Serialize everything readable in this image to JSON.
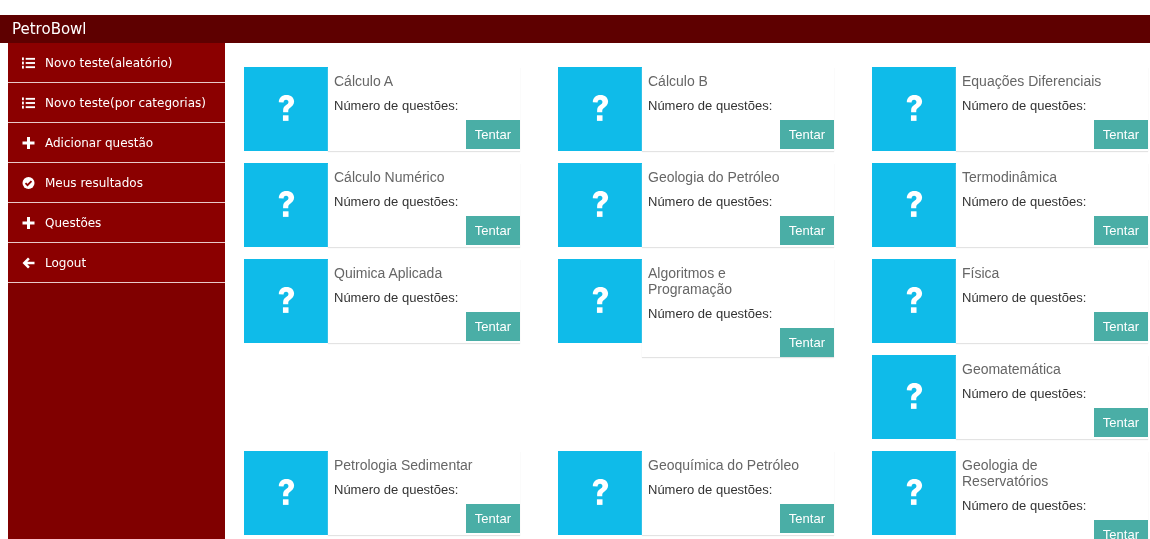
{
  "header": {
    "title": "PetroBowl"
  },
  "sidebar": {
    "items": [
      {
        "label": "Novo teste(aleatório)",
        "kind": "list"
      },
      {
        "label": "Novo teste(por categorias)",
        "kind": "list"
      },
      {
        "label": "Adicionar questão",
        "kind": "plus"
      },
      {
        "label": "Meus resultados",
        "kind": "check"
      },
      {
        "label": "Questões",
        "kind": "plus"
      },
      {
        "label": "Logout",
        "kind": "back"
      }
    ]
  },
  "card_groups": [
    {
      "cards": [
        {
          "title": "Cálculo A",
          "label": "Número de questões:",
          "button": "Tentar"
        },
        {
          "title": "Cálculo B",
          "label": "Número de questões:",
          "button": "Tentar"
        },
        {
          "title": "Equações Diferenciais",
          "label": "Número de questões:",
          "button": "Tentar"
        },
        {
          "title": "Cálculo Numérico",
          "label": "Número de questões:",
          "button": "Tentar"
        },
        {
          "title": "Geologia do Petróleo",
          "label": "Número de questões:",
          "button": "Tentar"
        },
        {
          "title": "Termodinâmica",
          "label": "Número de questões:",
          "button": "Tentar"
        },
        {
          "title": "Quimica Aplicada",
          "label": "Número de questões:",
          "button": "Tentar"
        },
        {
          "title": "Algoritmos e Programação",
          "label": "Número de questões:",
          "button": "Tentar"
        },
        {
          "title": "Física",
          "label": "Número de questões:",
          "button": "Tentar"
        },
        {
          "title": "Geomatemática",
          "label": "Número de questões:",
          "button": "Tentar"
        }
      ]
    },
    {
      "cards": [
        {
          "title": "Petrologia Sedimentar",
          "label": "Número de questões:",
          "button": "Tentar"
        },
        {
          "title": "Geoquímica do Petróleo",
          "label": "Número de questões:",
          "button": "Tentar"
        },
        {
          "title": "Geologia de Reservatórios",
          "label": "Número de questões:",
          "button": "Tentar"
        }
      ]
    }
  ]
}
